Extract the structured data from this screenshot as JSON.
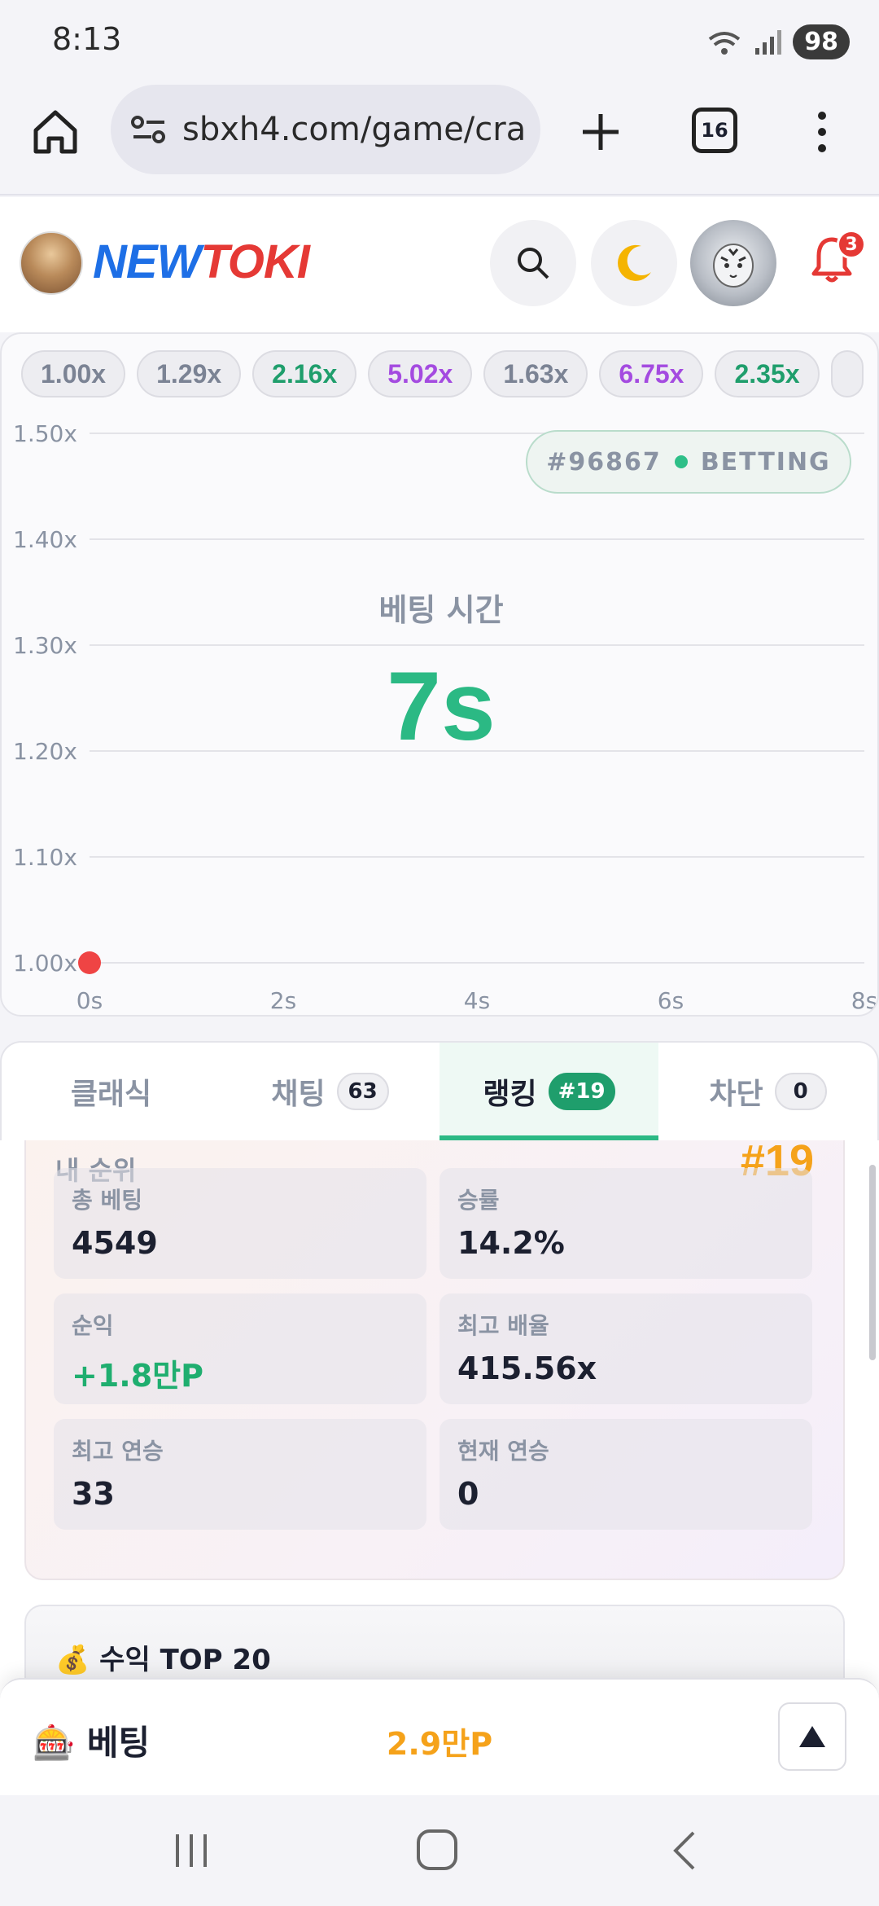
{
  "status": {
    "time": "8:13",
    "battery": "98"
  },
  "browser": {
    "url": "sbxh4.com/game/cra",
    "tab_count": "16"
  },
  "site": {
    "logo_text_1": "NEW",
    "logo_text_2": "TOKI",
    "notification_count": "3",
    "colors": {
      "logo_blue": "#1e6fe6",
      "logo_red": "#e53935"
    }
  },
  "history": [
    {
      "value": "1.00x",
      "color": "#7b8394"
    },
    {
      "value": "1.29x",
      "color": "#7b8394"
    },
    {
      "value": "2.16x",
      "color": "#1f9e6c"
    },
    {
      "value": "5.02x",
      "color": "#a44be0"
    },
    {
      "value": "1.63x",
      "color": "#7b8394"
    },
    {
      "value": "6.75x",
      "color": "#a44be0"
    },
    {
      "value": "2.35x",
      "color": "#1f9e6c"
    }
  ],
  "game": {
    "round": "#96867",
    "state": "BETTING",
    "bet_label": "베팅 시간",
    "countdown": "7s"
  },
  "chart_data": {
    "type": "line",
    "y_ticks": [
      "1.50x",
      "1.40x",
      "1.30x",
      "1.20x",
      "1.10x",
      "1.00x"
    ],
    "x_ticks": [
      "0s",
      "2s",
      "4s",
      "6s",
      "8s"
    ],
    "ylim": [
      1.0,
      1.5
    ],
    "xlim": [
      0,
      8
    ],
    "points": [
      {
        "x": 0,
        "y": 1.0
      }
    ],
    "point_color": "#ef4444"
  },
  "tabs": [
    {
      "label": "클래식",
      "badge": null,
      "active": false
    },
    {
      "label": "채팅",
      "badge": "63",
      "active": false
    },
    {
      "label": "랭킹",
      "badge": "#19",
      "active": true
    },
    {
      "label": "차단",
      "badge": "0",
      "active": false
    }
  ],
  "ranking": {
    "my_rank_label": "내 순위",
    "my_rank_value": "#19",
    "stats": [
      {
        "label": "총 베팅",
        "value": "4549",
        "color": "#1c2030"
      },
      {
        "label": "승률",
        "value": "14.2%",
        "color": "#1c2030"
      },
      {
        "label": "순익",
        "value": "+1.8만P",
        "color": "#1fae6f"
      },
      {
        "label": "최고 배율",
        "value": "415.56x",
        "color": "#1c2030"
      },
      {
        "label": "최고 연승",
        "value": "33",
        "color": "#1c2030"
      },
      {
        "label": "현재 연승",
        "value": "0",
        "color": "#1c2030"
      }
    ],
    "top20_title": "💰 수익 TOP 20"
  },
  "betbar": {
    "title": "🎰 베팅",
    "points": "2.9만P"
  }
}
